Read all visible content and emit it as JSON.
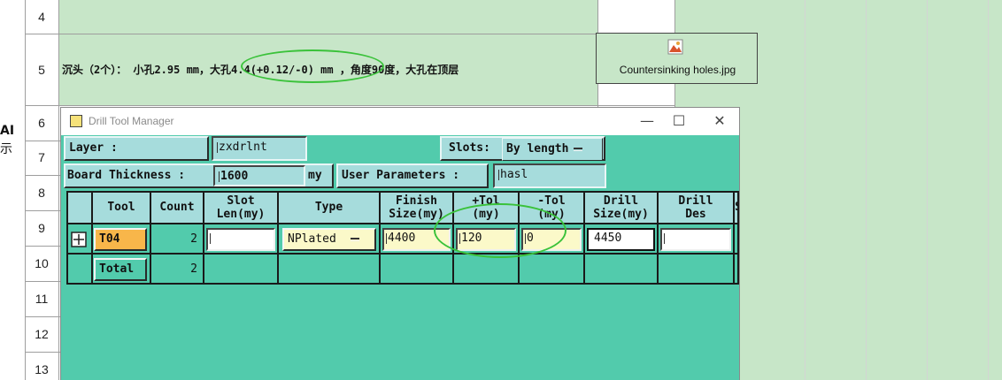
{
  "spreadsheet": {
    "row_numbers": [
      "4",
      "5",
      "6",
      "7",
      "8",
      "9",
      "10",
      "11",
      "12",
      "13"
    ],
    "left_cut_text": [
      "AI",
      "示"
    ],
    "row5_text": "沉头（2个）： 小孔2.95 mm，大孔4.4(+0.12/-0) mm ，角度90度，大孔在顶层",
    "attachment_filename": "Countersinking holes.jpg"
  },
  "dialog": {
    "title": "Drill Tool Manager",
    "minimize": "—",
    "maximize": "☐",
    "close": "✕",
    "layer_label": "Layer          :",
    "layer_value": "zxdrlnt",
    "slots_label": "Slots:",
    "slots_value": "By length",
    "board_thickness_label": "Board Thickness :",
    "board_thickness_value": "1600",
    "board_thickness_unit": "my",
    "user_params_label": "User Parameters :",
    "user_params_value": "hasl"
  },
  "table": {
    "headers": {
      "tool": "Tool",
      "count": "Count",
      "slot_len_1": "Slot",
      "slot_len_2": "Len(my)",
      "type": "Type",
      "finish_1": "Finish",
      "finish_2": "Size(my)",
      "ptol_1": "+Tol",
      "ptol_2": "(my)",
      "ntol_1": "-Tol",
      "ntol_2": "(my)",
      "drill_size_1": "Drill",
      "drill_size_2": "Size(my)",
      "drill_des_1": "Drill",
      "drill_des_2": "Des",
      "cut": "S"
    },
    "row1": {
      "tool": "T04",
      "count": "2",
      "slot_len": "",
      "type": "NPlated",
      "finish_size": "4400",
      "plus_tol": "120",
      "minus_tol": "0",
      "drill_size": "4450",
      "drill_des": ""
    },
    "total_row": {
      "label": "Total",
      "count": "2"
    }
  },
  "colors": {
    "dialog_bg": "#52cbac",
    "field_bg": "#a6dcdc",
    "tool_button": "#f8b64a",
    "sheet_green": "#c7e6c8",
    "highlight_ellipse": "#3ac23a"
  }
}
